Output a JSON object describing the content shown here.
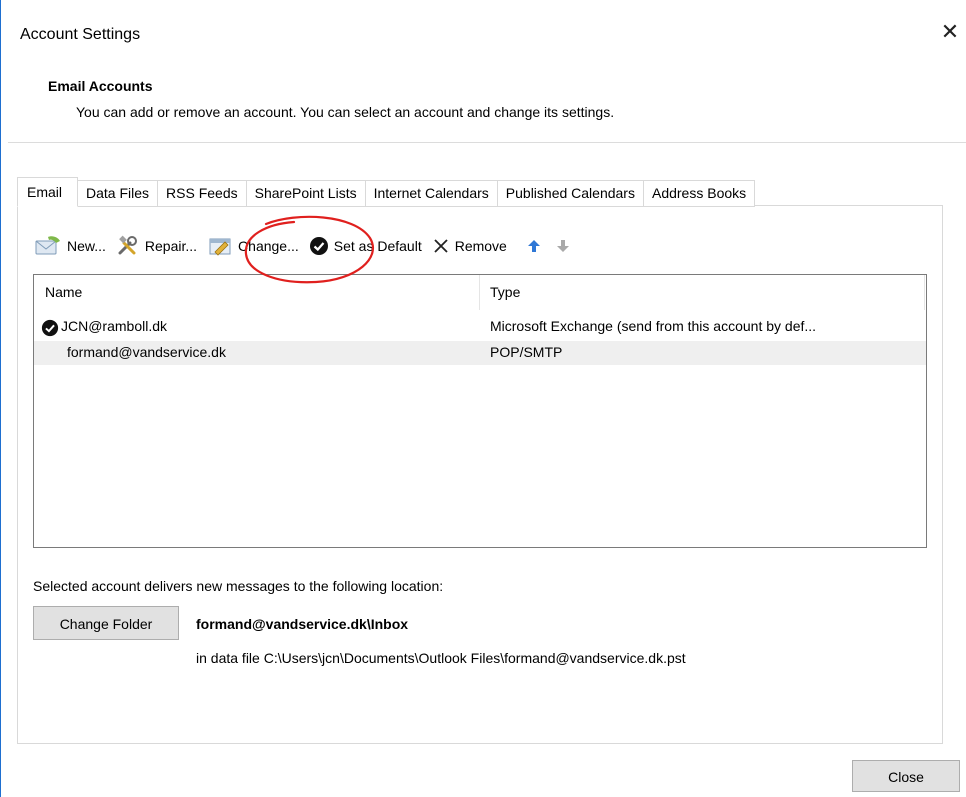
{
  "window": {
    "title": "Account Settings",
    "close_glyph": "✕"
  },
  "header": {
    "title": "Email Accounts",
    "description": "You can add or remove an account. You can select an account and change its settings."
  },
  "tabs": [
    {
      "label": "Email",
      "active": true
    },
    {
      "label": "Data Files"
    },
    {
      "label": "RSS Feeds"
    },
    {
      "label": "SharePoint Lists"
    },
    {
      "label": "Internet Calendars"
    },
    {
      "label": "Published Calendars"
    },
    {
      "label": "Address Books"
    }
  ],
  "toolbar": {
    "new_label": "New...",
    "repair_label": "Repair...",
    "change_label": "Change...",
    "set_default_label": "Set as Default",
    "remove_label": "Remove"
  },
  "accounts": {
    "columns": {
      "name": "Name",
      "type": "Type"
    },
    "rows": [
      {
        "name": "JCN@ramboll.dk",
        "type": "Microsoft Exchange (send from this account by def...",
        "default": true
      },
      {
        "name": "formand@vandservice.dk",
        "type": "POP/SMTP",
        "selected": true
      }
    ]
  },
  "delivery": {
    "label": "Selected account delivers new messages to the following location:",
    "change_folder_label": "Change Folder",
    "folder_path": "formand@vandservice.dk\\Inbox",
    "data_file": "in data file C:\\Users\\jcn\\Documents\\Outlook Files\\formand@vandservice.dk.pst"
  },
  "footer": {
    "close_label": "Close"
  },
  "colors": {
    "accent_blue": "#1e6fd0",
    "annotation_red": "#e0201e"
  }
}
